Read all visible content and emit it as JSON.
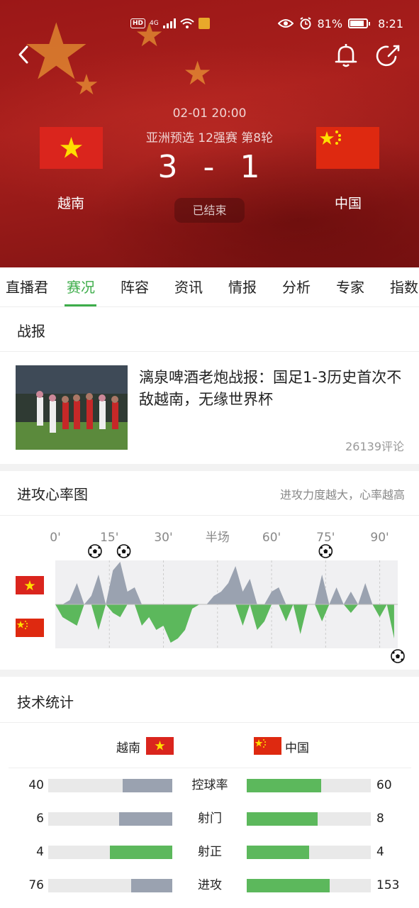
{
  "status_bar": {
    "hd": "HD",
    "network": "4G",
    "battery": "81%",
    "time": "8:21"
  },
  "match": {
    "datetime": "02-01 20:00",
    "league": "亚洲预选 12强赛 第8轮",
    "home_score": "3",
    "score_sep": "-",
    "away_score": "1",
    "status": "已结束",
    "home_team": "越南",
    "away_team": "中国"
  },
  "tabs": [
    "直播君",
    "赛况",
    "阵容",
    "资讯",
    "情报",
    "分析",
    "专家",
    "指数"
  ],
  "active_tab": 1,
  "report": {
    "title": "战报",
    "headline": "漓泉啤酒老炮战报：国足1-3历史首次不敌越南，无缘世界杯",
    "comments": "26139评论"
  },
  "heart_chart": {
    "title": "进攻心率图",
    "hint": "进攻力度越大，心率越高",
    "ticks": [
      "0'",
      "15'",
      "30'",
      "半场",
      "60'",
      "75'",
      "90'"
    ],
    "home_color": "#9aa2b0",
    "away_color": "#5cb85c",
    "home_goals_min": [
      11,
      19,
      75
    ],
    "away_goals_min": [
      95
    ]
  },
  "chart_data": {
    "type": "area",
    "title": "进攻心率图",
    "xlabel": "",
    "ylabel": "",
    "x_ticks": [
      "0'",
      "15'",
      "30'",
      "半场",
      "60'",
      "75'",
      "90'"
    ],
    "x": [
      0,
      2,
      4,
      6,
      8,
      10,
      12,
      14,
      16,
      18,
      20,
      22,
      24,
      26,
      28,
      30,
      32,
      34,
      36,
      38,
      40,
      42,
      44,
      46,
      48,
      50,
      52,
      54,
      56,
      58,
      60,
      62,
      64,
      66,
      68,
      70,
      72,
      74,
      76,
      78,
      80,
      82,
      84,
      86,
      88,
      90,
      92,
      94
    ],
    "series": [
      {
        "values": [
          0,
          0,
          0.1,
          0.5,
          0,
          0.2,
          0.7,
          0,
          0.8,
          1.0,
          0.3,
          0.4,
          0,
          0,
          0,
          0,
          0,
          0,
          0,
          0,
          0,
          0,
          0.2,
          0.3,
          0.5,
          0.9,
          0.3,
          0.6,
          0,
          0,
          0.3,
          0.4,
          0,
          0,
          0,
          0,
          0,
          0.7,
          0,
          0.4,
          0,
          0.3,
          0,
          0.5,
          0,
          0,
          0,
          0
        ]
      },
      {
        "values": [
          0,
          0.3,
          0.4,
          0.5,
          0,
          0,
          0.6,
          0,
          0.2,
          0.3,
          0,
          0,
          0.5,
          0.3,
          0.6,
          0.5,
          0.9,
          0.8,
          0.6,
          0.1,
          0,
          0,
          0,
          0,
          0,
          0,
          0.5,
          0,
          0.6,
          0.4,
          0,
          0,
          0.4,
          0,
          0.7,
          0,
          0,
          0.4,
          0,
          0,
          0,
          0.2,
          0,
          0,
          0,
          0.3,
          0,
          0.8
        ]
      }
    ]
  },
  "stats": {
    "title": "技术统计",
    "home_label": "越南",
    "away_label": "中国",
    "rows": [
      {
        "label": "控球率",
        "home": "40",
        "away": "60",
        "home_frac": 0.4,
        "away_frac": 0.6,
        "home_color": "grey",
        "away_color": "green"
      },
      {
        "label": "射门",
        "home": "6",
        "away": "8",
        "home_frac": 0.43,
        "away_frac": 0.57,
        "home_color": "grey",
        "away_color": "green"
      },
      {
        "label": "射正",
        "home": "4",
        "away": "4",
        "home_frac": 0.5,
        "away_frac": 0.5,
        "home_color": "green",
        "away_color": "green"
      },
      {
        "label": "进攻",
        "home": "76",
        "away": "153",
        "home_frac": 0.33,
        "away_frac": 0.67,
        "home_color": "grey",
        "away_color": "green"
      }
    ]
  }
}
